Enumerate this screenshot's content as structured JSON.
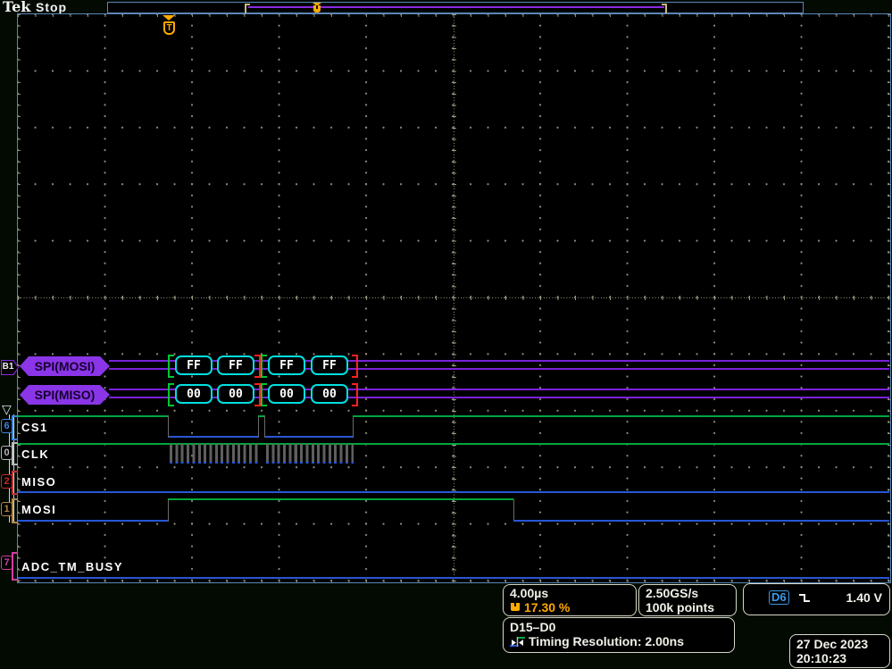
{
  "header": {
    "logo": "Tek",
    "status": "Stop"
  },
  "markers": {
    "trigger_letter": "T"
  },
  "bus": {
    "b1_label": "B1",
    "mosi": {
      "label": "SPI(MOSI)",
      "values": [
        "FF",
        "FF",
        "FF",
        "FF"
      ]
    },
    "miso": {
      "label": "SPI(MISO)",
      "values": [
        "00",
        "00",
        "00",
        "00"
      ]
    }
  },
  "digital_channels": [
    {
      "number": "6",
      "label": "CS1",
      "color": "#3c86d8"
    },
    {
      "number": "0",
      "label": "CLK",
      "color": "#b8b8b8"
    },
    {
      "number": "2",
      "label": "MISO",
      "color": "#c03030"
    },
    {
      "number": "1",
      "label": "MOSI",
      "color": "#b08648"
    },
    {
      "number": "7",
      "label": "ADC_TM_BUSY",
      "color": "#d040a0"
    }
  ],
  "readouts": {
    "timebase": {
      "scale": "4.00µs",
      "trigger_position": "17.30 %"
    },
    "acquisition": {
      "sample_rate": "2.50GS/s",
      "record_length": "100k points"
    },
    "trigger": {
      "source": "D6",
      "slope": "falling",
      "level": "1.40 V"
    },
    "digital": {
      "group": "D15–D0",
      "timing_resolution": "Timing Resolution: 2.00ns"
    },
    "datetime": {
      "date": "27 Dec 2023",
      "time": "20:10:23"
    }
  },
  "colors": {
    "bus_purple": "#8a35e8",
    "bus_box_cyan": "#00e0e0",
    "frame_green": "#00c832",
    "frame_red": "#ff2020",
    "high_green": "#00a73e",
    "low_blue": "#2857d4",
    "trigger_orange": "#ffaa00",
    "graticule_border": "#5c87b5"
  }
}
